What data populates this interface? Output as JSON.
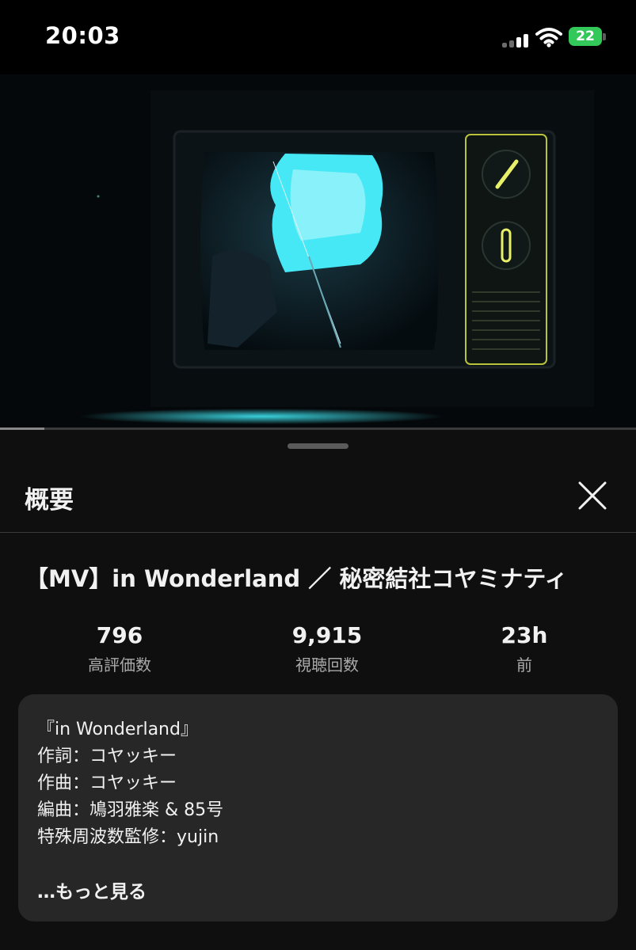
{
  "status_bar": {
    "time": "20:03",
    "battery": "22"
  },
  "video": {
    "progress": 0.07
  },
  "sheet": {
    "title": "概要",
    "video_title": "【MV】in Wonderland ／ 秘密結社コヤミナティ",
    "stats": [
      {
        "value": "796",
        "label": "高評価数"
      },
      {
        "value": "9,915",
        "label": "視聴回数"
      },
      {
        "value": "23h",
        "label": "前"
      }
    ],
    "description": {
      "lines": [
        "『in Wonderland』",
        "作詞：コヤッキー",
        "作曲：コヤッキー",
        "編曲：鳩羽雅楽 & 85号",
        "特殊周波数監修：yujin"
      ],
      "more": "…もっと見る"
    }
  },
  "icons": {
    "close": "close-icon",
    "wifi": "wifi-icon",
    "signal": "cellular-signal-icon",
    "battery": "battery-charging-icon"
  },
  "colors": {
    "background": "#0f0f0f",
    "panel": "#272727",
    "text": "#f1f1f1",
    "secondary_text": "#aaaaaa",
    "battery": "#33c95a",
    "screen_glow": "#3fe6f2"
  }
}
